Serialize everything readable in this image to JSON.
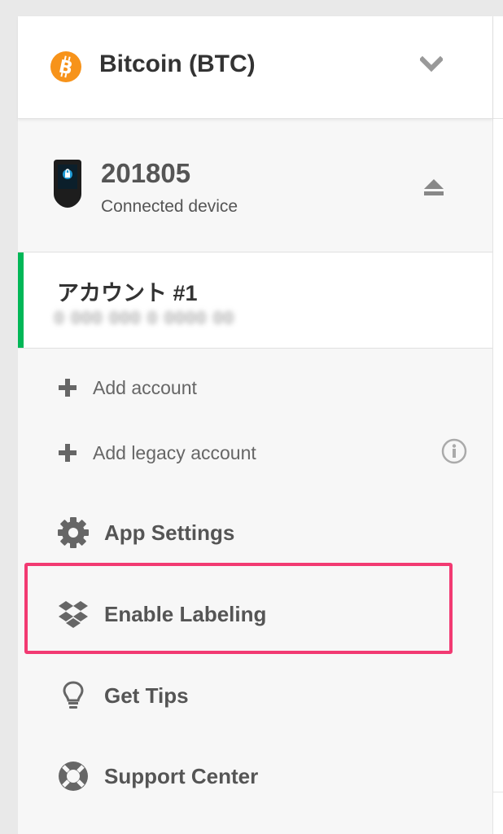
{
  "coin": {
    "name": "Bitcoin (BTC)",
    "icon": "bitcoin-icon",
    "accent": "#f7931a"
  },
  "device": {
    "name": "201805",
    "status": "Connected device",
    "icon": "trezor-device-icon"
  },
  "account": {
    "name": "アカウント #1",
    "balance": "0 000 000 0 0000 00",
    "accent": "#01b757"
  },
  "actions": {
    "add_account": "Add account",
    "add_legacy_account": "Add legacy account"
  },
  "menu": {
    "app_settings": "App Settings",
    "enable_labeling": "Enable Labeling",
    "get_tips": "Get Tips",
    "support_center": "Support Center"
  },
  "highlight_color": "#f23a72"
}
